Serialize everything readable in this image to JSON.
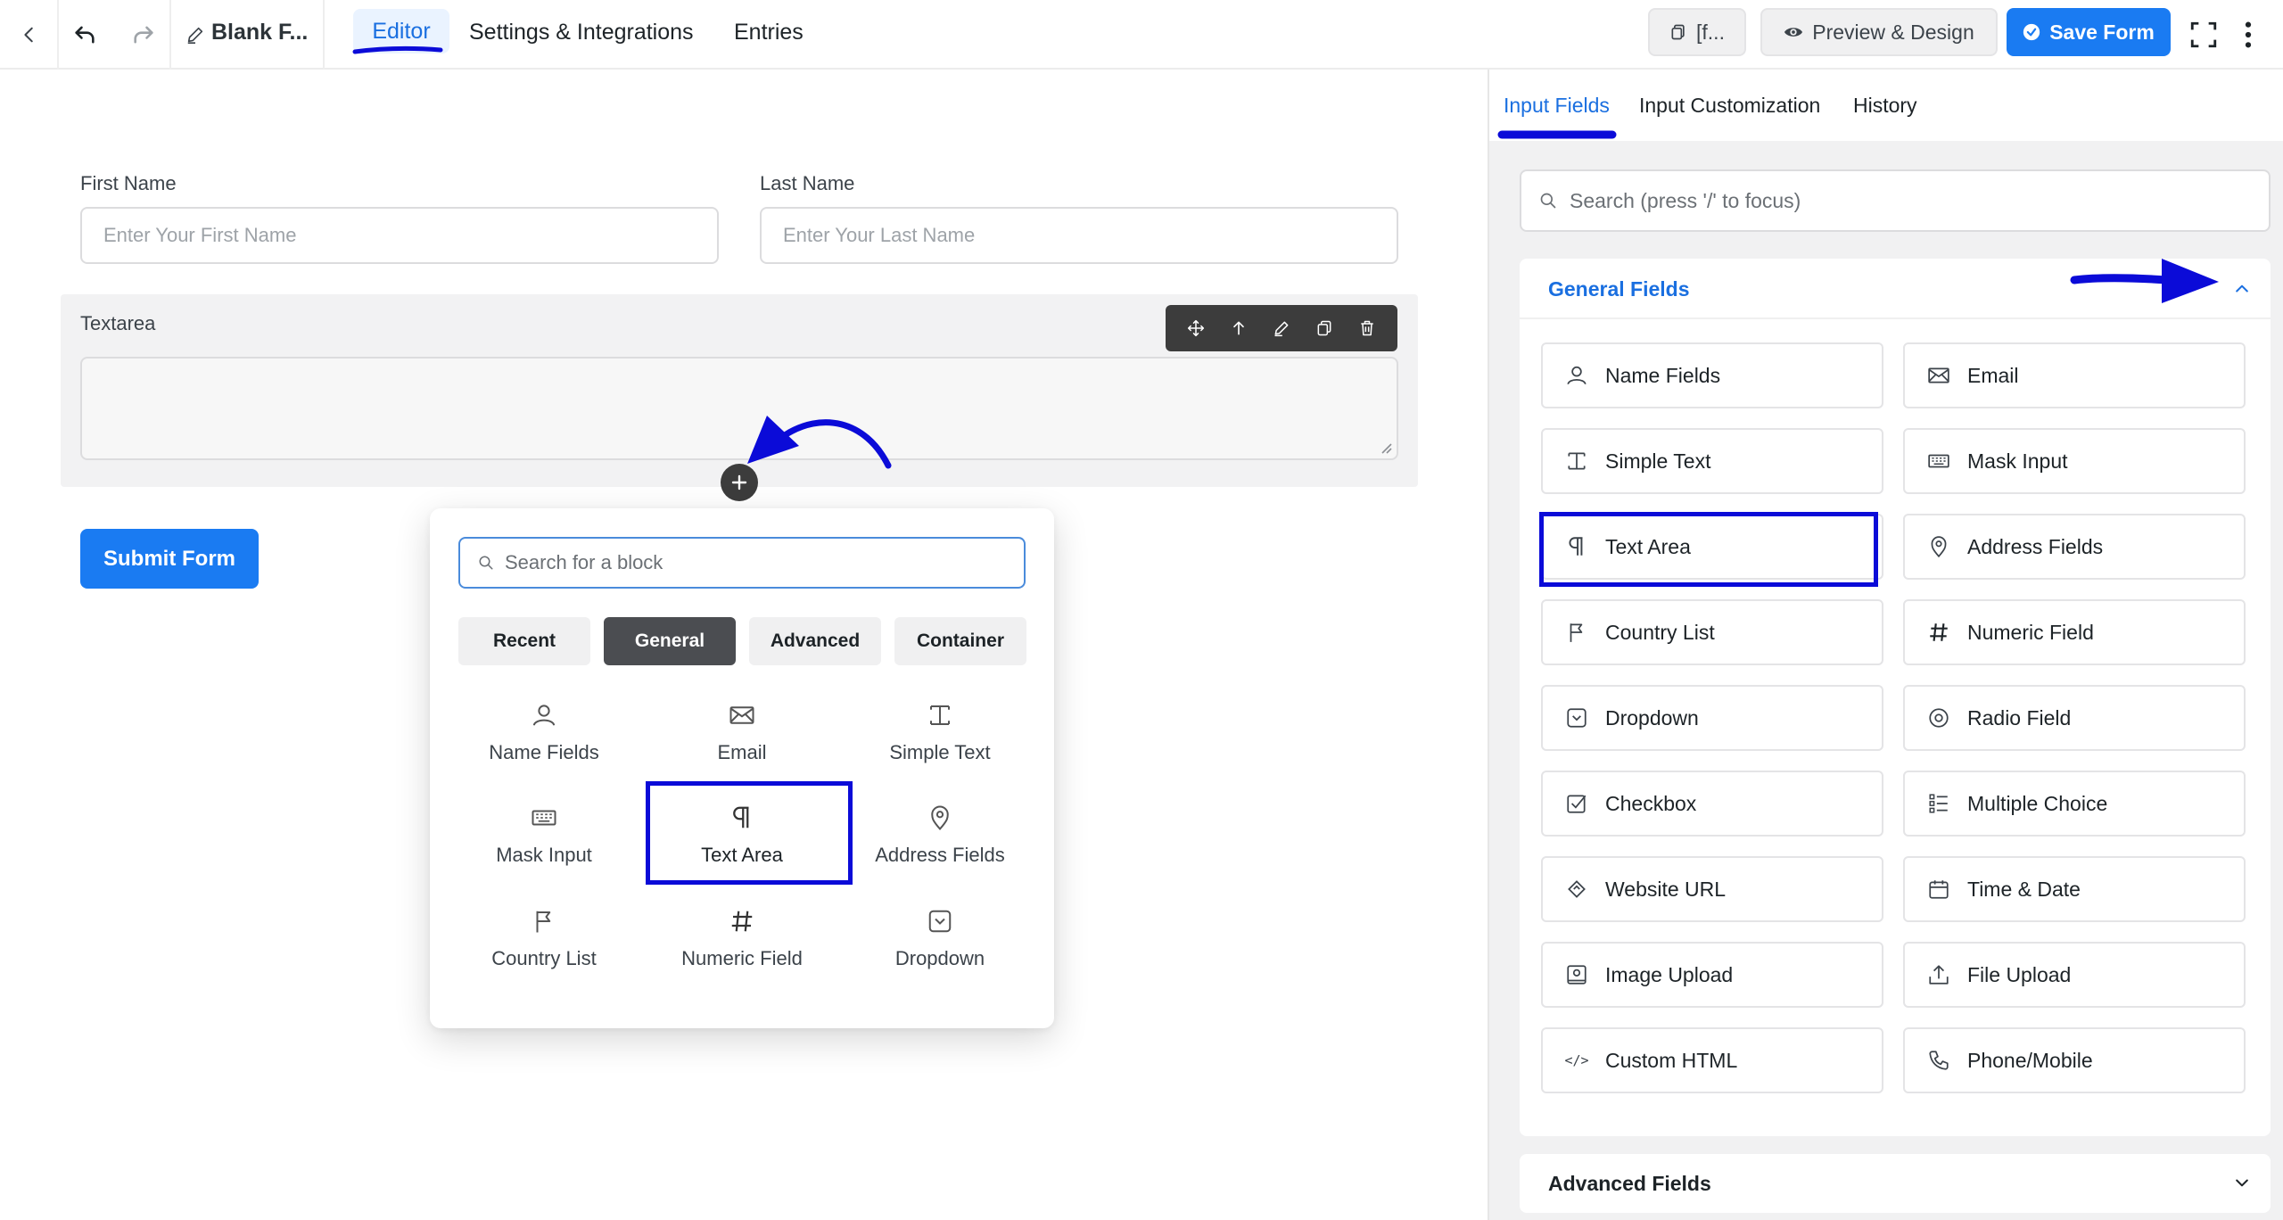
{
  "topbar": {
    "form_title": "Blank F...",
    "tabs": [
      "Editor",
      "Settings & Integrations",
      "Entries"
    ],
    "shortcode_label": "[f...",
    "preview_label": "Preview & Design",
    "save_label": "Save Form"
  },
  "form": {
    "first_name_label": "First Name",
    "first_name_placeholder": "Enter Your First Name",
    "last_name_label": "Last Name",
    "last_name_placeholder": "Enter Your Last Name",
    "textarea_label": "Textarea",
    "submit_label": "Submit Form"
  },
  "block_picker": {
    "search_placeholder": "Search for a block",
    "tabs": [
      "Recent",
      "General",
      "Advanced",
      "Container"
    ],
    "active_tab": "General",
    "items": [
      {
        "label": "Name Fields",
        "icon": "user-icon"
      },
      {
        "label": "Email",
        "icon": "envelope-icon"
      },
      {
        "label": "Simple Text",
        "icon": "text-cursor-icon"
      },
      {
        "label": "Mask Input",
        "icon": "keyboard-icon"
      },
      {
        "label": "Text Area",
        "icon": "paragraph-icon"
      },
      {
        "label": "Address Fields",
        "icon": "map-pin-icon"
      },
      {
        "label": "Country List",
        "icon": "flag-icon"
      },
      {
        "label": "Numeric Field",
        "icon": "hash-icon"
      },
      {
        "label": "Dropdown",
        "icon": "dropdown-icon"
      }
    ]
  },
  "right_panel": {
    "tabs": [
      "Input Fields",
      "Input Customization",
      "History"
    ],
    "search_placeholder": "Search (press '/' to focus)",
    "general_title": "General Fields",
    "advanced_title": "Advanced Fields",
    "fields": [
      {
        "label": "Name Fields",
        "icon": "user-icon"
      },
      {
        "label": "Email",
        "icon": "envelope-icon"
      },
      {
        "label": "Simple Text",
        "icon": "text-cursor-icon"
      },
      {
        "label": "Mask Input",
        "icon": "keyboard-icon"
      },
      {
        "label": "Text Area",
        "icon": "paragraph-icon"
      },
      {
        "label": "Address Fields",
        "icon": "map-pin-icon"
      },
      {
        "label": "Country List",
        "icon": "flag-icon"
      },
      {
        "label": "Numeric Field",
        "icon": "hash-icon"
      },
      {
        "label": "Dropdown",
        "icon": "dropdown-icon"
      },
      {
        "label": "Radio Field",
        "icon": "radio-icon"
      },
      {
        "label": "Checkbox",
        "icon": "checkbox-icon"
      },
      {
        "label": "Multiple Choice",
        "icon": "list-icon"
      },
      {
        "label": "Website URL",
        "icon": "link-icon"
      },
      {
        "label": "Time & Date",
        "icon": "calendar-icon"
      },
      {
        "label": "Image Upload",
        "icon": "image-icon"
      },
      {
        "label": "File Upload",
        "icon": "upload-icon"
      },
      {
        "label": "Custom HTML",
        "icon": "code-icon"
      },
      {
        "label": "Phone/Mobile",
        "icon": "phone-icon"
      }
    ]
  },
  "colors": {
    "accent": "#1a7bf2",
    "annotation": "#0b0bd8"
  }
}
